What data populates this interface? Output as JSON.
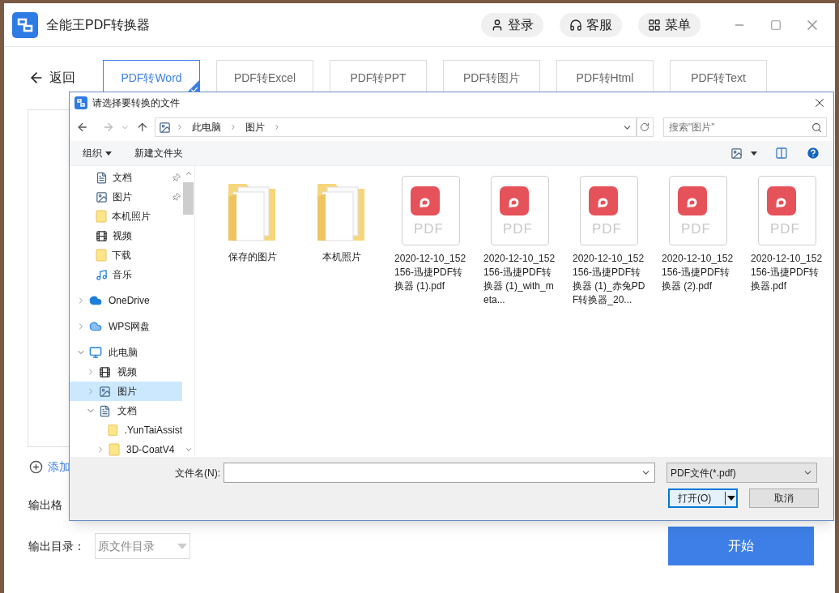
{
  "app": {
    "title": "全能王PDF转换器",
    "header_buttons": [
      {
        "kind": "user",
        "label": "登录"
      },
      {
        "kind": "support",
        "label": "客服"
      },
      {
        "kind": "menu",
        "label": "菜单"
      }
    ],
    "back": "返回",
    "tabs": [
      {
        "label": "PDF转Word",
        "selected": true
      },
      {
        "label": "PDF转Excel",
        "selected": false
      },
      {
        "label": "PDF转PPT",
        "selected": false
      },
      {
        "label": "PDF转图片",
        "selected": false
      },
      {
        "label": "PDF转Html",
        "selected": false
      },
      {
        "label": "PDF转Text",
        "selected": false
      }
    ],
    "add": "添加",
    "output_format_label": "输出格",
    "output_dir_label": "输出目录：",
    "output_dir": {
      "value": "原文件目录"
    },
    "start": "开始"
  },
  "dialog": {
    "title": "请选择要转换的文件",
    "address": [
      "此电脑",
      "图片"
    ],
    "search": {
      "placeholder": "搜索\"图片\""
    },
    "toolbar": [
      "组织",
      "新建文件夹"
    ],
    "quick_access": [
      {
        "kind": "doc",
        "label": "文档",
        "pinned": true,
        "selected": false
      },
      {
        "kind": "pictures",
        "label": "图片",
        "pinned": true,
        "selected": false
      },
      {
        "kind": "folder",
        "label": "本机照片",
        "pinned": false,
        "selected": false
      },
      {
        "kind": "video",
        "label": "视频",
        "pinned": false,
        "selected": false
      },
      {
        "kind": "folder",
        "label": "下载",
        "pinned": false,
        "selected": false
      },
      {
        "kind": "music",
        "label": "音乐",
        "pinned": false,
        "selected": false
      }
    ],
    "tree": [
      {
        "kind": "cloud",
        "label": "OneDrive",
        "expanded": false,
        "selected": false
      },
      {
        "kind": "wps",
        "label": "WPS网盘",
        "expanded": false,
        "selected": false
      },
      {
        "kind": "pc",
        "label": "此电脑",
        "expanded": true,
        "selected": false,
        "children": [
          {
            "kind": "video",
            "label": "视频",
            "expanded": false,
            "selected": false
          },
          {
            "kind": "pictures",
            "label": "图片",
            "expanded": false,
            "selected": true
          },
          {
            "kind": "doc",
            "label": "文档",
            "expanded": true,
            "selected": false,
            "children": [
              {
                "kind": "folder",
                "label": ".YunTaiAssist",
                "selected": false
              },
              {
                "kind": "folder",
                "label": "3D-CoatV4",
                "expanded": false,
                "selected": false
              }
            ]
          }
        ]
      }
    ],
    "files": [
      {
        "kind": "folder",
        "name": "保存的图片"
      },
      {
        "kind": "folder",
        "name": "本机照片"
      },
      {
        "kind": "pdf",
        "icon_text": "PDF",
        "name": "2020-12-10_152156-迅捷PDF转换器 (1).pdf"
      },
      {
        "kind": "pdf",
        "icon_text": "PDF",
        "name": "2020-12-10_152156-迅捷PDF转换器 (1)_with_meta..."
      },
      {
        "kind": "pdf",
        "icon_text": "PDF",
        "name": "2020-12-10_152156-迅捷PDF转换器 (1)_赤兔PDF转换器_20..."
      },
      {
        "kind": "pdf",
        "icon_text": "PDF",
        "name": "2020-12-10_152156-迅捷PDF转换器 (2).pdf"
      },
      {
        "kind": "pdf",
        "icon_text": "PDF",
        "name": "2020-12-10_152156-迅捷PDF转换器.pdf"
      }
    ],
    "filename_label": "文件名(N):",
    "filetype": "PDF文件(*.pdf)",
    "open": "打开(O)",
    "cancel": "取消"
  }
}
